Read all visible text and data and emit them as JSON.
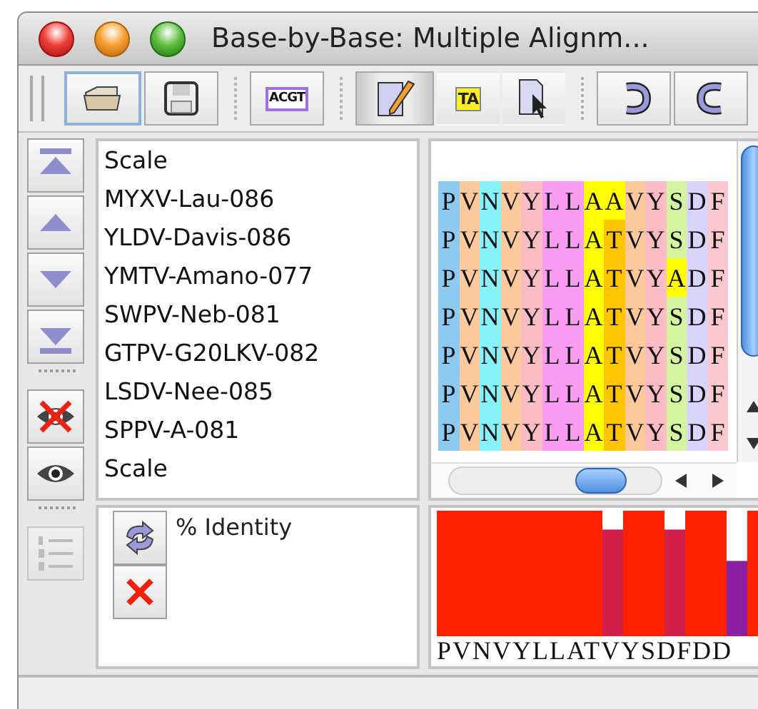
{
  "window": {
    "title": "Base-by-Base: Multiple Alignm..."
  },
  "toolbar": [
    {
      "kind": "open",
      "pressed": false,
      "focused": true
    },
    {
      "kind": "save",
      "pressed": false,
      "focused": false
    },
    {
      "kind": "sequence",
      "label": "ACGT",
      "pressed": false,
      "focused": false
    },
    {
      "kind": "edit",
      "pressed": true,
      "focused": false
    },
    {
      "kind": "translate",
      "label": "TA",
      "pressed": false,
      "focused": false
    },
    {
      "kind": "select",
      "pressed": false,
      "focused": false
    },
    {
      "kind": "undo",
      "pressed": false,
      "focused": false
    },
    {
      "kind": "redo",
      "pressed": false,
      "focused": false
    }
  ],
  "side_tools": [
    {
      "kind": "move-top",
      "disabled": false
    },
    {
      "kind": "move-up",
      "disabled": false
    },
    {
      "kind": "move-down",
      "disabled": false
    },
    {
      "kind": "move-bottom",
      "disabled": false
    },
    {
      "kind": "hide",
      "disabled": false
    },
    {
      "kind": "show",
      "disabled": false
    },
    {
      "kind": "numbering",
      "disabled": true
    }
  ],
  "sequence_names": [
    "Scale",
    "MYXV-Lau-086",
    "YLDV-Davis-086",
    "YMTV-Amano-077",
    "SWPV-Neb-081",
    "GTPV-G20LKV-082",
    "LSDV-Nee-085",
    "SPPV-A-081",
    "Scale"
  ],
  "alignment": [
    {
      "residues": [
        {
          "letter": "P",
          "color": "#8ec9f2"
        },
        {
          "letter": "V",
          "color": "#fbc99c"
        },
        {
          "letter": "N",
          "color": "#88f2fb"
        },
        {
          "letter": "V",
          "color": "#fbc99c"
        },
        {
          "letter": "Y",
          "color": "#fbbcc4"
        },
        {
          "letter": "L",
          "color": "#f99cf2"
        },
        {
          "letter": "L",
          "color": "#f99cf2"
        },
        {
          "letter": "A",
          "color": "#ffff00"
        },
        {
          "letter": "A",
          "color": "#ffff00"
        },
        {
          "letter": "V",
          "color": "#fbc99c"
        },
        {
          "letter": "Y",
          "color": "#fbbcc4"
        },
        {
          "letter": "S",
          "color": "#d4f4a2"
        },
        {
          "letter": "D",
          "color": "#d8d4fb"
        },
        {
          "letter": "F",
          "color": "#fbc8d0"
        }
      ]
    },
    {
      "residues": [
        {
          "letter": "P",
          "color": "#8ec9f2"
        },
        {
          "letter": "V",
          "color": "#fbc99c"
        },
        {
          "letter": "N",
          "color": "#88f2fb"
        },
        {
          "letter": "V",
          "color": "#fbc99c"
        },
        {
          "letter": "Y",
          "color": "#fbbcc4"
        },
        {
          "letter": "L",
          "color": "#f99cf2"
        },
        {
          "letter": "L",
          "color": "#f99cf2"
        },
        {
          "letter": "A",
          "color": "#ffff00"
        },
        {
          "letter": "T",
          "color": "#ffc600"
        },
        {
          "letter": "V",
          "color": "#fbc99c"
        },
        {
          "letter": "Y",
          "color": "#fbbcc4"
        },
        {
          "letter": "S",
          "color": "#d4f4a2"
        },
        {
          "letter": "D",
          "color": "#d8d4fb"
        },
        {
          "letter": "F",
          "color": "#fbc8d0"
        }
      ]
    },
    {
      "residues": [
        {
          "letter": "P",
          "color": "#8ec9f2"
        },
        {
          "letter": "V",
          "color": "#fbc99c"
        },
        {
          "letter": "N",
          "color": "#88f2fb"
        },
        {
          "letter": "V",
          "color": "#fbc99c"
        },
        {
          "letter": "Y",
          "color": "#fbbcc4"
        },
        {
          "letter": "L",
          "color": "#f99cf2"
        },
        {
          "letter": "L",
          "color": "#f99cf2"
        },
        {
          "letter": "A",
          "color": "#ffff00"
        },
        {
          "letter": "T",
          "color": "#ffc600"
        },
        {
          "letter": "V",
          "color": "#fbc99c"
        },
        {
          "letter": "Y",
          "color": "#fbbcc4"
        },
        {
          "letter": "A",
          "color": "#ffff00"
        },
        {
          "letter": "D",
          "color": "#d8d4fb"
        },
        {
          "letter": "F",
          "color": "#fbc8d0"
        }
      ]
    },
    {
      "residues": [
        {
          "letter": "P",
          "color": "#8ec9f2"
        },
        {
          "letter": "V",
          "color": "#fbc99c"
        },
        {
          "letter": "N",
          "color": "#88f2fb"
        },
        {
          "letter": "V",
          "color": "#fbc99c"
        },
        {
          "letter": "Y",
          "color": "#fbbcc4"
        },
        {
          "letter": "L",
          "color": "#f99cf2"
        },
        {
          "letter": "L",
          "color": "#f99cf2"
        },
        {
          "letter": "A",
          "color": "#ffff00"
        },
        {
          "letter": "T",
          "color": "#ffc600"
        },
        {
          "letter": "V",
          "color": "#fbc99c"
        },
        {
          "letter": "Y",
          "color": "#fbbcc4"
        },
        {
          "letter": "S",
          "color": "#d4f4a2"
        },
        {
          "letter": "D",
          "color": "#d8d4fb"
        },
        {
          "letter": "F",
          "color": "#fbc8d0"
        }
      ]
    },
    {
      "residues": [
        {
          "letter": "P",
          "color": "#8ec9f2"
        },
        {
          "letter": "V",
          "color": "#fbc99c"
        },
        {
          "letter": "N",
          "color": "#88f2fb"
        },
        {
          "letter": "V",
          "color": "#fbc99c"
        },
        {
          "letter": "Y",
          "color": "#fbbcc4"
        },
        {
          "letter": "L",
          "color": "#f99cf2"
        },
        {
          "letter": "L",
          "color": "#f99cf2"
        },
        {
          "letter": "A",
          "color": "#ffff00"
        },
        {
          "letter": "T",
          "color": "#ffc600"
        },
        {
          "letter": "V",
          "color": "#fbc99c"
        },
        {
          "letter": "Y",
          "color": "#fbbcc4"
        },
        {
          "letter": "S",
          "color": "#d4f4a2"
        },
        {
          "letter": "D",
          "color": "#d8d4fb"
        },
        {
          "letter": "F",
          "color": "#fbc8d0"
        }
      ]
    },
    {
      "residues": [
        {
          "letter": "P",
          "color": "#8ec9f2"
        },
        {
          "letter": "V",
          "color": "#fbc99c"
        },
        {
          "letter": "N",
          "color": "#88f2fb"
        },
        {
          "letter": "V",
          "color": "#fbc99c"
        },
        {
          "letter": "Y",
          "color": "#fbbcc4"
        },
        {
          "letter": "L",
          "color": "#f99cf2"
        },
        {
          "letter": "L",
          "color": "#f99cf2"
        },
        {
          "letter": "A",
          "color": "#ffff00"
        },
        {
          "letter": "T",
          "color": "#ffc600"
        },
        {
          "letter": "V",
          "color": "#fbc99c"
        },
        {
          "letter": "Y",
          "color": "#fbbcc4"
        },
        {
          "letter": "S",
          "color": "#d4f4a2"
        },
        {
          "letter": "D",
          "color": "#d8d4fb"
        },
        {
          "letter": "F",
          "color": "#fbc8d0"
        }
      ]
    },
    {
      "residues": [
        {
          "letter": "P",
          "color": "#8ec9f2"
        },
        {
          "letter": "V",
          "color": "#fbc99c"
        },
        {
          "letter": "N",
          "color": "#88f2fb"
        },
        {
          "letter": "V",
          "color": "#fbc99c"
        },
        {
          "letter": "Y",
          "color": "#fbbcc4"
        },
        {
          "letter": "L",
          "color": "#f99cf2"
        },
        {
          "letter": "L",
          "color": "#f99cf2"
        },
        {
          "letter": "A",
          "color": "#ffff00"
        },
        {
          "letter": "T",
          "color": "#ffc600"
        },
        {
          "letter": "V",
          "color": "#fbc99c"
        },
        {
          "letter": "Y",
          "color": "#fbbcc4"
        },
        {
          "letter": "S",
          "color": "#d4f4a2"
        },
        {
          "letter": "D",
          "color": "#d8d4fb"
        },
        {
          "letter": "F",
          "color": "#fbc8d0"
        }
      ]
    }
  ],
  "annotation": {
    "label": "% Identity",
    "tools": [
      {
        "kind": "refresh"
      },
      {
        "kind": "delete"
      }
    ],
    "consensus": "PVNVYLLATVYSDFDD"
  }
}
